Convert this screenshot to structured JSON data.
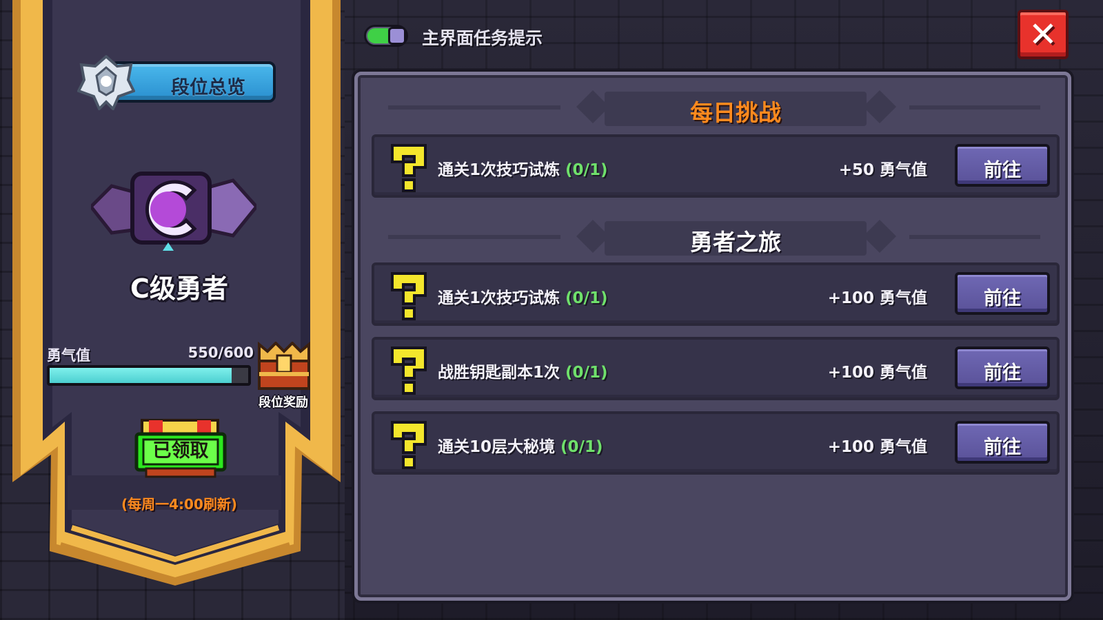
{
  "top_bar": {
    "task_hint_label": "主界面任务提示",
    "task_hint_toggle_on": true,
    "close_label": "✕"
  },
  "left_panel": {
    "rank_overview_label": "段位总览",
    "rank_name": "C级勇者",
    "courage_label": "勇气值",
    "courage_value": "550/600",
    "courage_current": 550,
    "courage_max": 600,
    "rank_reward_label": "段位奖励",
    "claimed_label": "已领取",
    "refresh_note": "(每周一4:00刷新)"
  },
  "daily_section": {
    "title": "每日挑战",
    "tasks": [
      {
        "name": "通关1次技巧试炼",
        "progress": "(0/1)",
        "reward": "+50 勇气值",
        "button": "前往"
      }
    ]
  },
  "journey_section": {
    "title": "勇者之旅",
    "tasks": [
      {
        "name": "通关1次技巧试炼",
        "progress": "(0/1)",
        "reward": "+100 勇气值",
        "button": "前往"
      },
      {
        "name": "战胜钥匙副本1次",
        "progress": "(0/1)",
        "reward": "+100 勇气值",
        "button": "前往"
      },
      {
        "name": "通关10层大秘境",
        "progress": "(0/1)",
        "reward": "+100 勇气值",
        "button": "前往"
      }
    ]
  },
  "colors": {
    "accent_orange": "#ff8a1e",
    "progress_green": "#6fe06b",
    "courage_bar": "#4ccfd0",
    "button_purple": "#6f68b4",
    "close_red": "#e8322c"
  },
  "icons": [
    "silver-rank-emblem-icon",
    "c-rank-badge-icon",
    "rank-reward-chest-icon",
    "claimed-chest-icon",
    "question-mark-icon",
    "close-icon"
  ]
}
